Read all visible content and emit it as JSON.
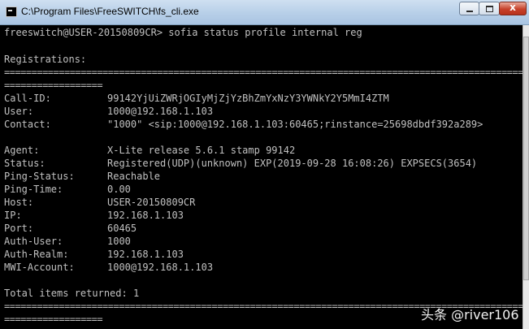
{
  "window": {
    "title": "C:\\Program Files\\FreeSWITCH\\fs_cli.exe",
    "buttons": {
      "minimize": "",
      "maximize": "",
      "close": "x"
    }
  },
  "console": {
    "prompt": "freeswitch@USER-20150809CR> sofia status profile internal reg",
    "header": "Registrations:",
    "rule_top": "==================================================================================================================",
    "rule_top_cont": "==================",
    "fields": [
      {
        "key": "Call-ID:",
        "value": "99142YjUiZWRjOGIyMjZjYzBhZmYxNzY3YWNkY2Y5MmI4ZTM"
      },
      {
        "key": "User:",
        "value": "1000@192.168.1.103"
      },
      {
        "key": "Contact:",
        "value": "\"1000\" <sip:1000@192.168.1.103:60465;rinstance=25698dbdf392a289>"
      },
      {
        "key": "Agent:",
        "value": "X-Lite release 5.6.1 stamp 99142"
      },
      {
        "key": "Status:",
        "value": "Registered(UDP)(unknown) EXP(2019-09-28 16:08:26) EXPSECS(3654)"
      },
      {
        "key": "Ping-Status:",
        "value": "Reachable"
      },
      {
        "key": "Ping-Time:",
        "value": "0.00"
      },
      {
        "key": "Host:",
        "value": "USER-20150809CR"
      },
      {
        "key": "IP:",
        "value": "192.168.1.103"
      },
      {
        "key": "Port:",
        "value": "60465"
      },
      {
        "key": "Auth-User:",
        "value": "1000"
      },
      {
        "key": "Auth-Realm:",
        "value": "192.168.1.103"
      },
      {
        "key": "MWI-Account:",
        "value": "1000@192.168.1.103"
      }
    ],
    "total": "Total items returned: 1",
    "rule_bottom": "==================================================================================================================",
    "rule_bottom_cont": "=================="
  },
  "watermark": "头条 @river106"
}
